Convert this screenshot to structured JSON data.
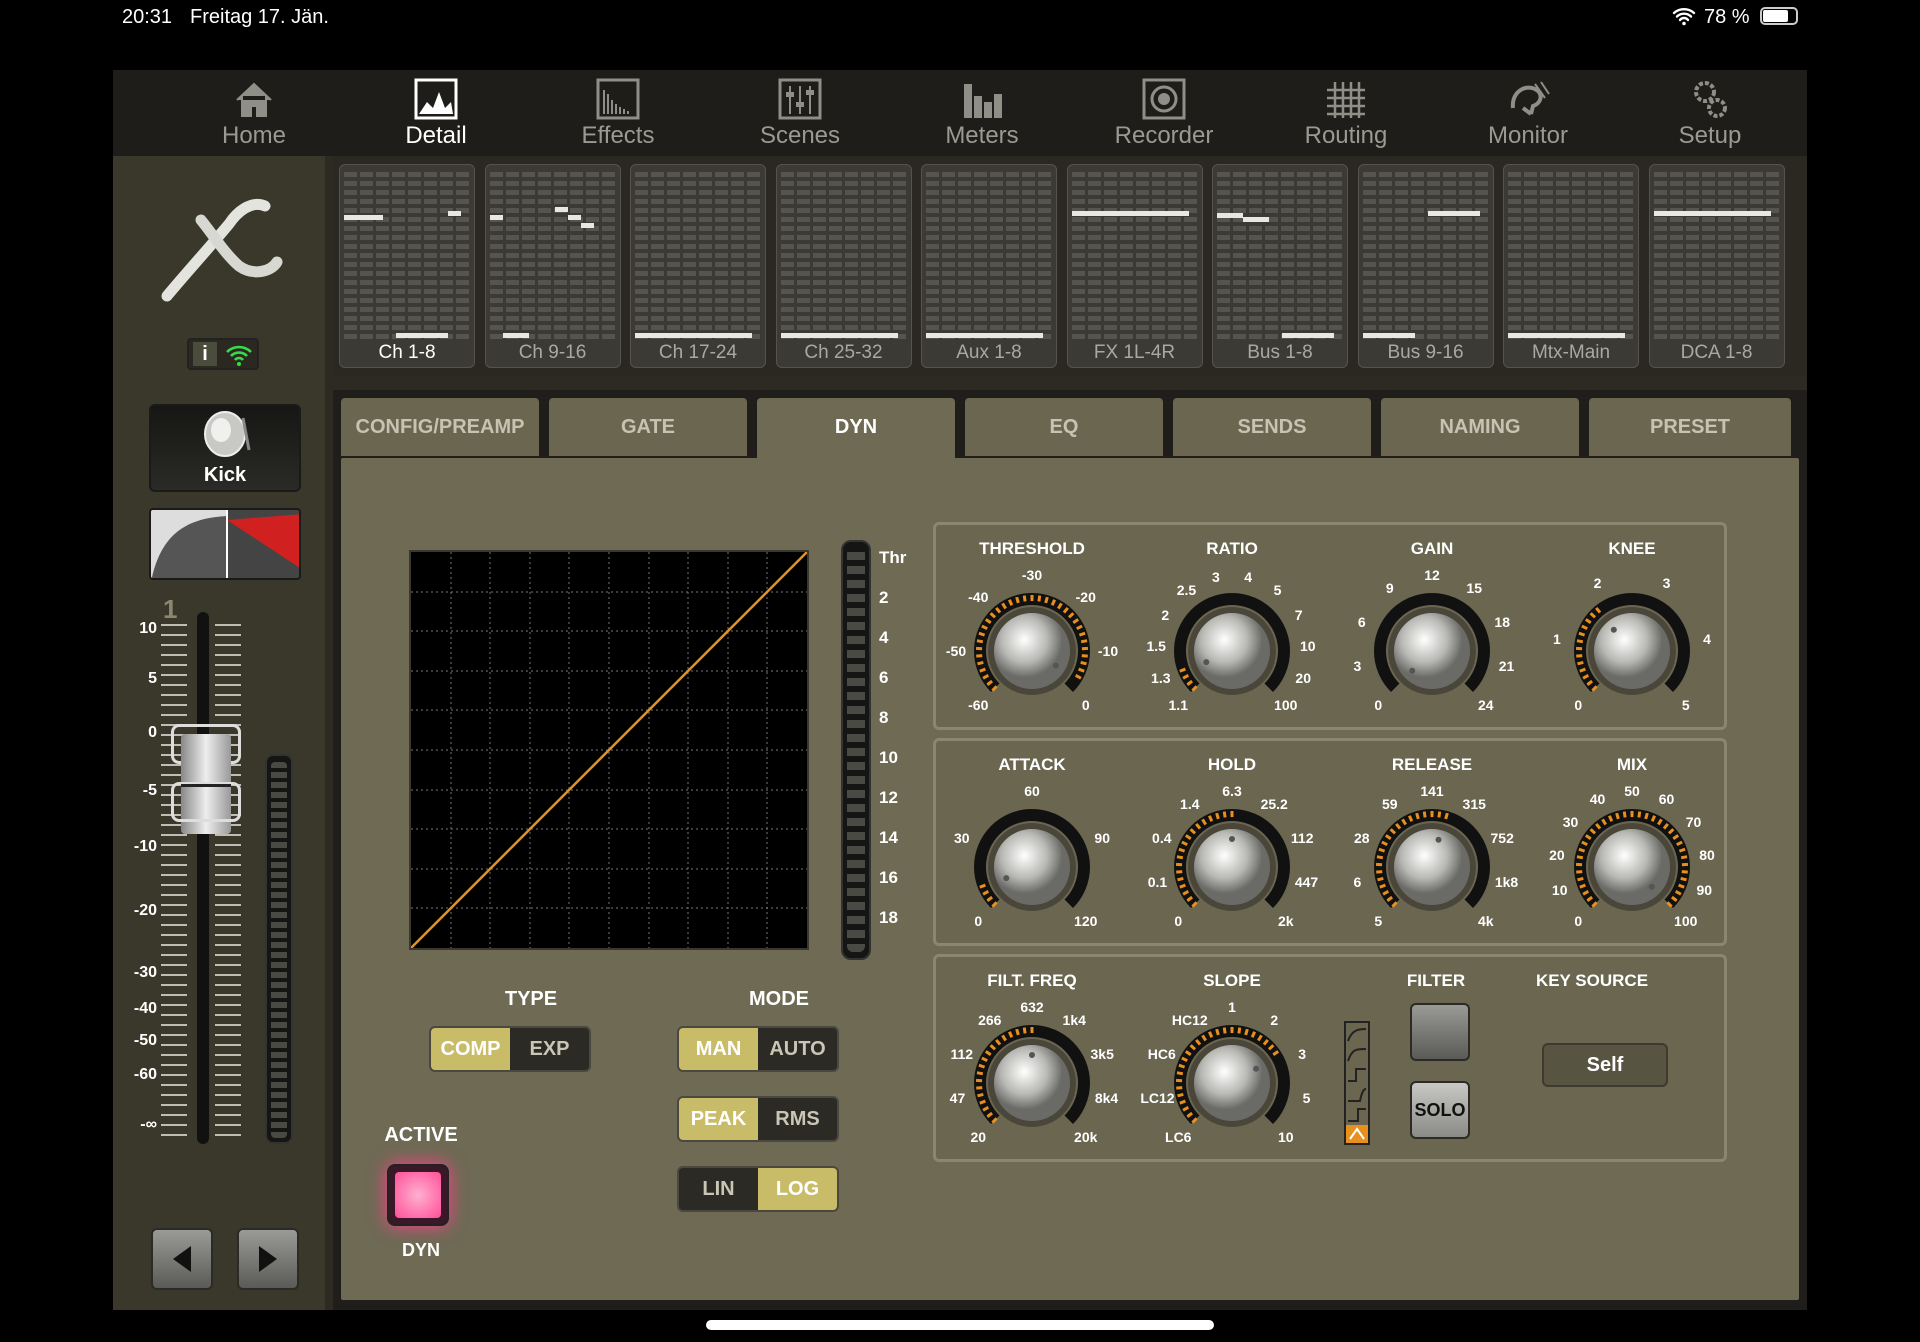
{
  "status": {
    "time": "20:31",
    "date": "Freitag 17. Jän.",
    "battery": "78 %",
    "wifi_icon": "wifi-icon",
    "battery_icon": "battery-icon"
  },
  "nav": [
    {
      "label": "Home",
      "icon": "home-icon"
    },
    {
      "label": "Detail",
      "icon": "detail-icon"
    },
    {
      "label": "Effects",
      "icon": "effects-icon"
    },
    {
      "label": "Scenes",
      "icon": "scenes-icon"
    },
    {
      "label": "Meters",
      "icon": "meters-icon"
    },
    {
      "label": "Recorder",
      "icon": "recorder-icon"
    },
    {
      "label": "Routing",
      "icon": "routing-icon"
    },
    {
      "label": "Monitor",
      "icon": "monitor-icon"
    },
    {
      "label": "Setup",
      "icon": "setup-icon"
    }
  ],
  "nav_active": "Detail",
  "banks": [
    "Ch 1-8",
    "Ch 9-16",
    "Ch 17-24",
    "Ch 25-32",
    "Aux 1-8",
    "FX 1L-4R",
    "Bus 1-8",
    "Bus 9-16",
    "Mtx-Main",
    "DCA 1-8"
  ],
  "channel": {
    "name": "Kick",
    "number": "1",
    "info_label": "i"
  },
  "fader_scale": [
    "10",
    "5",
    "0",
    "-5",
    "-10",
    "-20",
    "-30",
    "-40",
    "-50",
    "-60",
    "-∞"
  ],
  "tabs": [
    "CONFIG/PREAMP",
    "GATE",
    "DYN",
    "EQ",
    "SENDS",
    "NAMING",
    "PRESET"
  ],
  "active_tab": "DYN",
  "thr_scale": [
    "Thr",
    "2",
    "4",
    "6",
    "8",
    "10",
    "12",
    "14",
    "16",
    "18"
  ],
  "type": {
    "title": "TYPE",
    "options": [
      "COMP",
      "EXP"
    ],
    "selected": "COMP"
  },
  "mode": {
    "title": "MODE",
    "options": [
      "MAN",
      "AUTO"
    ],
    "selected": "MAN"
  },
  "detect": {
    "options": [
      "PEAK",
      "RMS"
    ],
    "selected": "PEAK"
  },
  "env": {
    "options": [
      "LIN",
      "LOG"
    ],
    "selected": "LOG"
  },
  "active": {
    "title": "ACTIVE",
    "label": "DYN",
    "on": true
  },
  "row1": [
    {
      "label": "THRESHOLD",
      "ticks": [
        "-60",
        "-50",
        "-40",
        "-30",
        "-20",
        "-10",
        "0"
      ],
      "level": 0.95
    },
    {
      "label": "RATIO",
      "ticks": [
        "1.1",
        "1.3",
        "1.5",
        "2",
        "2.5",
        "3",
        "4",
        "5",
        "7",
        "10",
        "20",
        "100"
      ],
      "level": 0.08
    },
    {
      "label": "GAIN",
      "ticks": [
        "0",
        "3",
        "6",
        "9",
        "12",
        "15",
        "18",
        "21",
        "24"
      ],
      "level": 0.0
    },
    {
      "label": "KNEE",
      "ticks": [
        "0",
        "1",
        "2",
        "3",
        "4",
        "5"
      ],
      "level": 0.35
    }
  ],
  "row2": [
    {
      "label": "ATTACK",
      "ticks": [
        "0",
        "30",
        "60",
        "90",
        "120"
      ],
      "level": 0.08
    },
    {
      "label": "HOLD",
      "ticks": [
        "0",
        "0.1",
        "0.4",
        "1.4",
        "6.3",
        "25.2",
        "112",
        "447",
        "2k"
      ],
      "level": 0.5
    },
    {
      "label": "RELEASE",
      "ticks": [
        "5",
        "6",
        "28",
        "59",
        "141",
        "315",
        "752",
        "1k8",
        "4k"
      ],
      "level": 0.55
    },
    {
      "label": "MIX",
      "ticks": [
        "0",
        "10",
        "20",
        "30",
        "40",
        "50",
        "60",
        "70",
        "80",
        "90",
        "100"
      ],
      "level": 1.0
    }
  ],
  "row3": {
    "filt_freq": {
      "label": "FILT. FREQ",
      "ticks": [
        "20",
        "47",
        "112",
        "266",
        "632",
        "1k4",
        "3k5",
        "8k4",
        "20k"
      ],
      "level": 0.5
    },
    "slope": {
      "label": "SLOPE",
      "ticks": [
        "LC6",
        "LC12",
        "HC6",
        "HC12",
        "1",
        "2",
        "3",
        "5",
        "10"
      ],
      "level": 0.72
    },
    "filter": {
      "label": "FILTER",
      "solo": "SOLO"
    },
    "key_source": {
      "label": "KEY SOURCE",
      "value": "Self"
    }
  },
  "colors": {
    "accent": "#e8901e",
    "panel": "#6e6a54",
    "active_led": "#ff5fa0"
  }
}
